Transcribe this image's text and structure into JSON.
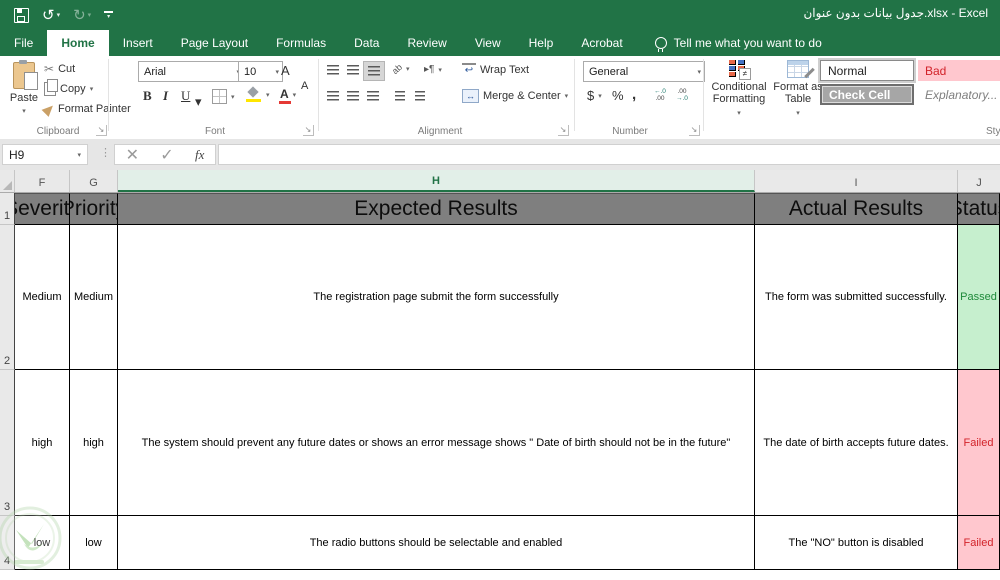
{
  "titlebar": {
    "title": "جدول بيانات بدون عنوان.xlsx - Excel"
  },
  "tabs": {
    "file": "File",
    "home": "Home",
    "insert": "Insert",
    "page_layout": "Page Layout",
    "formulas": "Formulas",
    "data": "Data",
    "review": "Review",
    "view": "View",
    "help": "Help",
    "acrobat": "Acrobat",
    "tellme": "Tell me what you want to do"
  },
  "ribbon": {
    "clipboard": {
      "label": "Clipboard",
      "paste": "Paste",
      "cut": "Cut",
      "copy": "Copy",
      "format_painter": "Format Painter"
    },
    "font": {
      "label": "Font",
      "family": "Arial",
      "size": "10",
      "bold": "B",
      "italic": "I",
      "underline": "U"
    },
    "alignment": {
      "label": "Alignment",
      "wrap_text": "Wrap Text",
      "merge_center": "Merge & Center"
    },
    "number": {
      "label": "Number",
      "format": "General",
      "currency": "$",
      "percent": "%",
      "comma": ","
    },
    "styles": {
      "label": "Styles",
      "conditional_formatting": "Conditional Formatting",
      "format_as_table": "Format as Table",
      "normal": "Normal",
      "bad": "Bad",
      "check_cell": "Check Cell",
      "explanatory": "Explanatory..."
    }
  },
  "formula_bar": {
    "name_box": "H9",
    "cancel": "✕",
    "enter": "✓",
    "fx": "fx",
    "value": ""
  },
  "sheet": {
    "columns": [
      "F",
      "G",
      "H",
      "I",
      "J"
    ],
    "header_cells": [
      "Severity",
      "Priority",
      "Expected Results",
      "Actual Results",
      "Status"
    ],
    "row1_num": "1",
    "rows": [
      {
        "num": "2",
        "severity": "Medium",
        "priority": "Medium",
        "expected": "The registration page submit the form successfully",
        "actual": "The form was submitted successfully.",
        "status": "Passed"
      },
      {
        "num": "3",
        "severity": "high",
        "priority": "high",
        "expected": "The system should prevent any future dates or shows an error message shows \" Date of birth should not be in the future\"",
        "actual": "The date of birth accepts future dates.",
        "status": "Failed"
      },
      {
        "num": "4",
        "severity": "low",
        "priority": "low",
        "expected": "The radio buttons should be selectable and enabled",
        "actual": "The \"NO\" button is disabled",
        "status": "Failed"
      }
    ]
  },
  "colors": {
    "accent": "#217346",
    "header_cell_bg": "#7f7f7f",
    "passed_bg": "#c6efce",
    "passed_text": "#1f8a3b",
    "failed_bg": "#ffc7ce",
    "failed_text": "#d2232a"
  }
}
